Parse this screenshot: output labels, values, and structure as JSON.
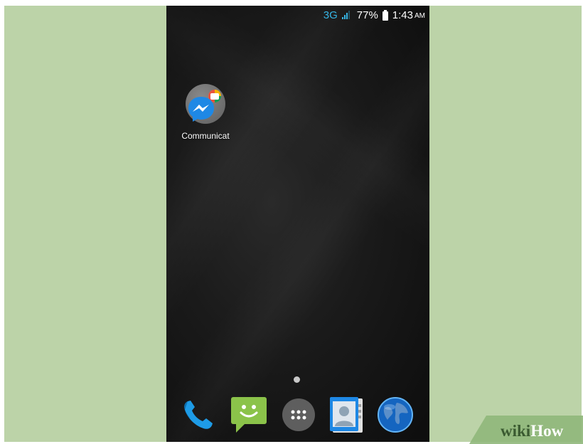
{
  "status_bar": {
    "network": "3G",
    "battery_percent": "77%",
    "time": "1:43",
    "ampm": "AM"
  },
  "home": {
    "shortcut_label": "Communicat"
  },
  "dock": {
    "items": [
      "phone-icon",
      "messaging-icon",
      "app-drawer-icon",
      "contacts-icon",
      "browser-globe-icon"
    ]
  },
  "watermark": "wikiHow",
  "colors": {
    "frame_bg": "#bcd3a8",
    "signal_accent": "#35b5e5",
    "messenger_blue": "#1e88e5"
  }
}
